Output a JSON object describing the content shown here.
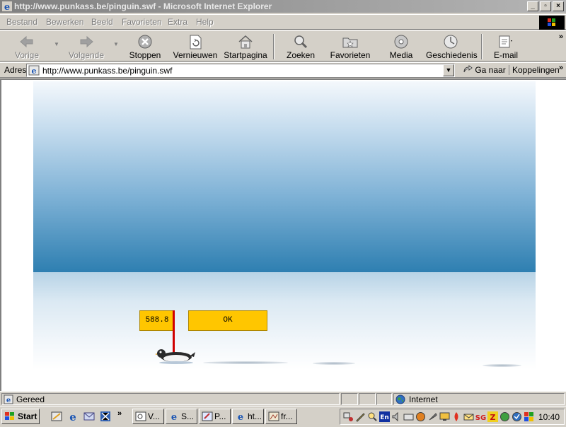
{
  "window": {
    "title": "http://www.punkass.be/pinguin.swf - Microsoft Internet Explorer",
    "minimize": "_",
    "maximize": "▫",
    "close": "×"
  },
  "menu": [
    "Bestand",
    "Bewerken",
    "Beeld",
    "Favorieten",
    "Extra",
    "Help"
  ],
  "toolbar": {
    "back": "Vorige",
    "forward": "Volgende",
    "stop": "Stoppen",
    "refresh": "Vernieuwen",
    "home": "Startpagina",
    "search": "Zoeken",
    "favorites": "Favorieten",
    "media": "Media",
    "history": "Geschiedenis",
    "mail": "E-mail",
    "more": "»"
  },
  "address": {
    "label": "Adres",
    "url": "http://www.punkass.be/pinguin.swf",
    "go": "Ga naar",
    "links": "Koppelingen",
    "more": "»"
  },
  "game": {
    "score": "588.8",
    "ok_label": "OK"
  },
  "status": {
    "text": "Gereed",
    "zone": "Internet"
  },
  "taskbar": {
    "start": "Start",
    "quicklaunch_more": "»",
    "tasks": [
      "V...",
      "S...",
      "P...",
      "ht...",
      "fr..."
    ],
    "clock": "10:40"
  }
}
